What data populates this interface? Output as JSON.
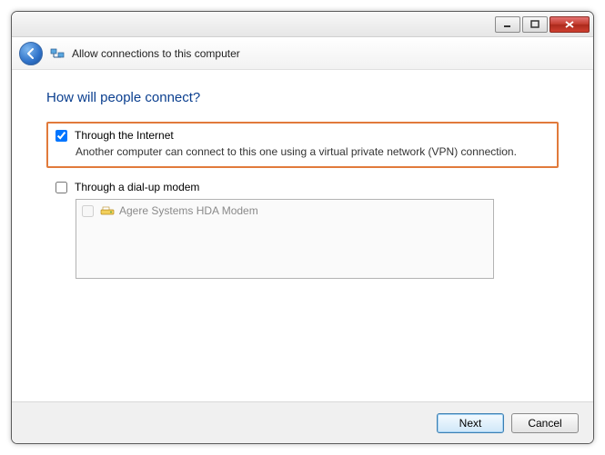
{
  "header": {
    "title": "Allow connections to this computer"
  },
  "main": {
    "heading": "How will people connect?",
    "internet": {
      "label": "Through the Internet",
      "description": "Another computer can connect to this one using a virtual private network (VPN) connection.",
      "checked": true
    },
    "dialup": {
      "label": "Through a dial-up modem",
      "checked": false,
      "modems": [
        {
          "name": "Agere Systems HDA Modem",
          "checked": false
        }
      ]
    }
  },
  "footer": {
    "next": "Next",
    "cancel": "Cancel"
  }
}
